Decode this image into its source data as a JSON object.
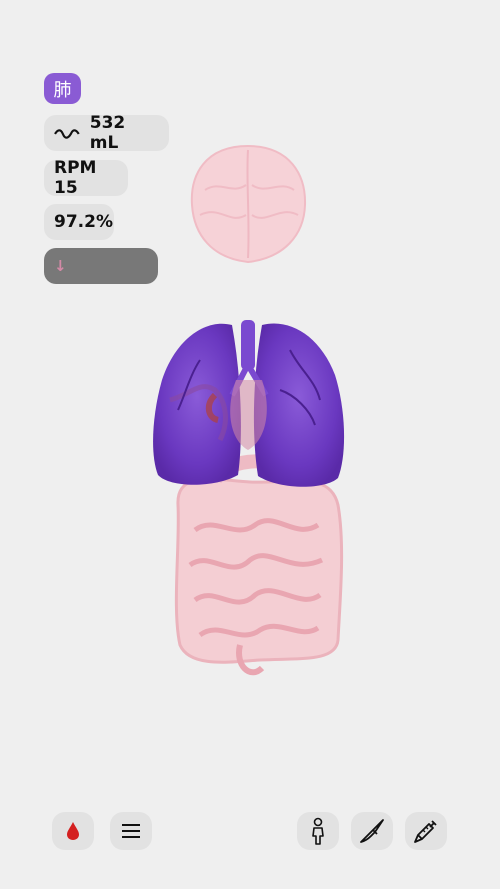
{
  "organ_label": "肺",
  "stats": {
    "volume": "532 mL",
    "rpm": "RPM 15",
    "spo2": "97.2%",
    "trend_symbol": "↓"
  },
  "colors": {
    "organ_chip": "#8a5bd4",
    "lungs": "#7443c8",
    "faded_organs": "#f3c4cc",
    "blood_icon": "#d42020"
  },
  "toolbar": {
    "left": [
      {
        "icon": "blood-drop-icon"
      },
      {
        "icon": "menu-icon"
      }
    ],
    "right": [
      {
        "icon": "person-icon"
      },
      {
        "icon": "scalpel-icon"
      },
      {
        "icon": "syringe-icon"
      }
    ]
  }
}
